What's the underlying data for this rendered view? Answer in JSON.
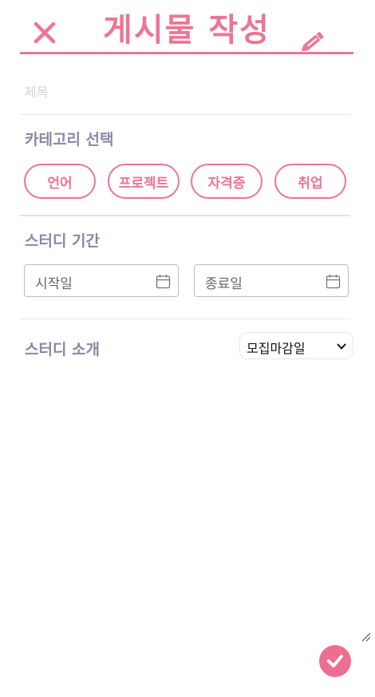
{
  "header": {
    "title": "게시물 작성",
    "close_icon": "close-icon",
    "edit_icon": "pencil-icon"
  },
  "title_field": {
    "placeholder": "제목",
    "value": ""
  },
  "category": {
    "label": "카테고리 선택",
    "chips": [
      {
        "label": "언어"
      },
      {
        "label": "프로젝트"
      },
      {
        "label": "자격증"
      },
      {
        "label": "취업"
      }
    ]
  },
  "period": {
    "label": "스터디 기간",
    "start_placeholder": "시작일",
    "end_placeholder": "종료일",
    "calendar_icon": "calendar-icon"
  },
  "intro": {
    "label": "스터디 소개",
    "deadline_select": {
      "selected": "모집마감일"
    },
    "value": ""
  },
  "submit": {
    "icon": "check-icon"
  },
  "colors": {
    "accent": "#ec7595",
    "label": "#8a87a3",
    "placeholder": "#d2d2d2"
  }
}
